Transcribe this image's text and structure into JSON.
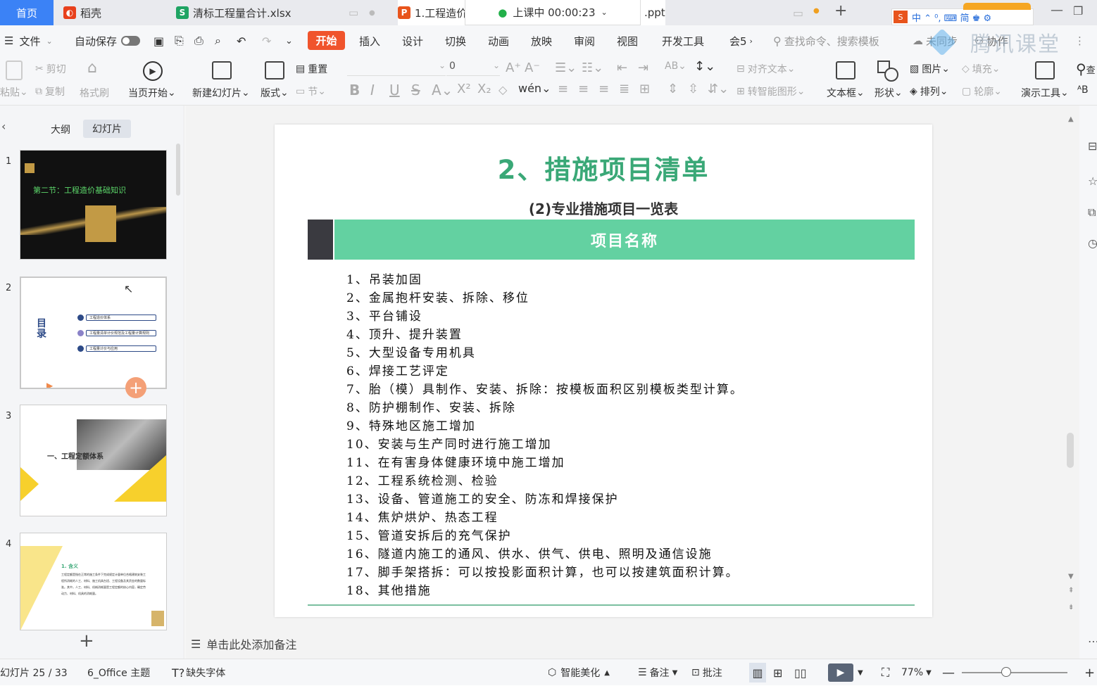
{
  "tabs": {
    "home": "首页",
    "daoke": "稻壳",
    "excel": "清标工程量合计.xlsx",
    "ppt": "1.工程造价",
    "ppt_suffix": ".ppt"
  },
  "live_badge": "上课中 00:00:23",
  "menu": {
    "file": "文件",
    "autosave": "自动保存",
    "items": [
      "开始",
      "插入",
      "设计",
      "切换",
      "动画",
      "放映",
      "审阅",
      "视图",
      "开发工具",
      "会5"
    ],
    "search_placeholder": "查找命令、搜索模板",
    "unsync": "未同步",
    "collab": "协作",
    "watermark": "腾讯课堂"
  },
  "ime_bar": "中 ⌃ ⁰, ⌨ 简 ♚ ⚙",
  "ribbon": {
    "paste": "粘贴",
    "cut": "剪切",
    "copy": "复制",
    "format_painter": "格式刷",
    "from_current": "当页开始",
    "new_slide": "新建幻灯片",
    "layout": "版式",
    "reset": "重置",
    "section": "节",
    "font_size": "0",
    "align_text": "对齐文本",
    "smart_art": "转智能图形",
    "textbox": "文本框",
    "shape": "形状",
    "picture": "图片",
    "arrange": "排列",
    "fill": "填充",
    "outline": "轮廓",
    "present_tools": "演示工具",
    "find": "查"
  },
  "panel": {
    "tab_outline": "大纲",
    "tab_slides": "幻灯片",
    "thumbs": [
      {
        "num": "1",
        "text": "第二节：工程造价基础知识"
      },
      {
        "num": "2",
        "title": "目录",
        "items": [
          "工程造价体系",
          "工程量清单计价规范及工程量计算规则",
          "工程量计价与应用"
        ]
      },
      {
        "num": "3",
        "text": "一、工程定额体系"
      },
      {
        "num": "4",
        "heading": "1. 含义",
        "body": "工程定额是指在正常的施工条件下完成规定计量单位合格建筑安装工程所消耗的人工、材料、施工机具台班、工程设备及其资金的数量标准。其中，人工、材料、机械消耗量是工程定额的核心内容，确定劳动力、材料、机具的消耗量。"
      }
    ]
  },
  "slide": {
    "title": "2、措施项目清单",
    "subtitle": "(2)专业措施项目一览表",
    "header": "项目名称",
    "items": [
      "1、吊装加固",
      "2、金属抱杆安装、拆除、移位",
      "3、平台铺设",
      "4、顶升、提升装置",
      "5、大型设备专用机具",
      "6、焊接工艺评定",
      "7、胎（模）具制作、安装、拆除：按模板面积区别模板类型计算。",
      "8、防护棚制作、安装、拆除",
      "9、特殊地区施工增加",
      "10、安装与生产同时进行施工增加",
      "11、在有害身体健康环境中施工增加",
      "12、工程系统检测、检验",
      "13、设备、管道施工的安全、防冻和焊接保护",
      "14、焦炉烘炉、热态工程",
      "15、管道安拆后的充气保护",
      "16、隧道内施工的通风、供水、供气、供电、照明及通信设施",
      "17、脚手架搭拆：可以按投影面积计算，也可以按建筑面积计算。",
      "18、其他措施"
    ]
  },
  "notes_placeholder": "单击此处添加备注",
  "status": {
    "slide_count": "幻灯片 25 / 33",
    "theme": "6_Office 主题",
    "missing_font": "缺失字体",
    "beautify": "智能美化",
    "notes": "备注",
    "comment": "批注",
    "zoom": "77%"
  },
  "colors": {
    "accent": "#f0542c",
    "slide_green": "#3aa877",
    "header_green": "#63d1a1",
    "dark_block": "#3a3a40"
  }
}
